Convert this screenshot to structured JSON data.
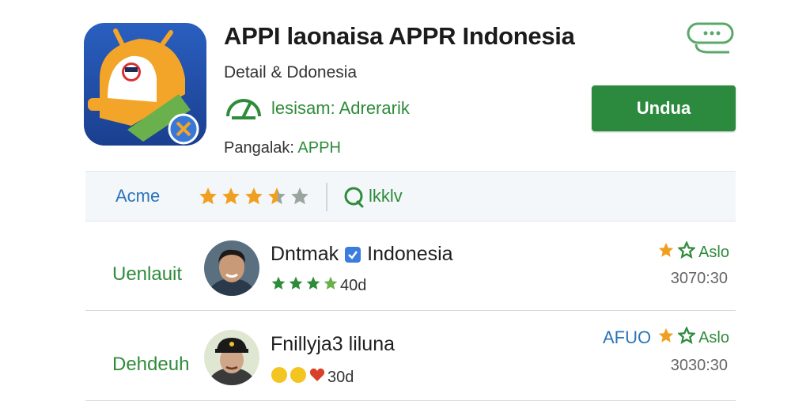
{
  "app": {
    "title": "APPI laonaisa APPR Indonesia",
    "subtitle": "Detail &  Ddonesia",
    "developer_label": "lesisam: Adrerarik",
    "pangalak_label": "Pangalak: ",
    "pangalak_value": "APPH",
    "icon": "android-app-icon"
  },
  "actions": {
    "install_label": "Undua",
    "chat_icon": "chat-bubble-icon"
  },
  "rating_bar": {
    "label": "Acme",
    "stars_filled": 3.5,
    "stars_total": 5,
    "link_label": "lkklv"
  },
  "reviews": [
    {
      "side_label": "Uenlauit",
      "name": "Dntmak",
      "name_suffix": "Indonesia",
      "verified": true,
      "meta_value": "40d",
      "right_label": "Aslo",
      "time": "3070:30"
    },
    {
      "side_label": "Dehdeuh",
      "name": "Fnillyja3 liluna",
      "meta_value": "30d",
      "right_extra": "AFUO",
      "right_label": "Aslo",
      "time": "3030:30"
    }
  ],
  "colors": {
    "accent_green": "#2b8a3e",
    "text_green": "#2e8b3a",
    "link_blue": "#2a74b8",
    "star_orange": "#f0a020",
    "star_gray": "#9aa5a0"
  }
}
